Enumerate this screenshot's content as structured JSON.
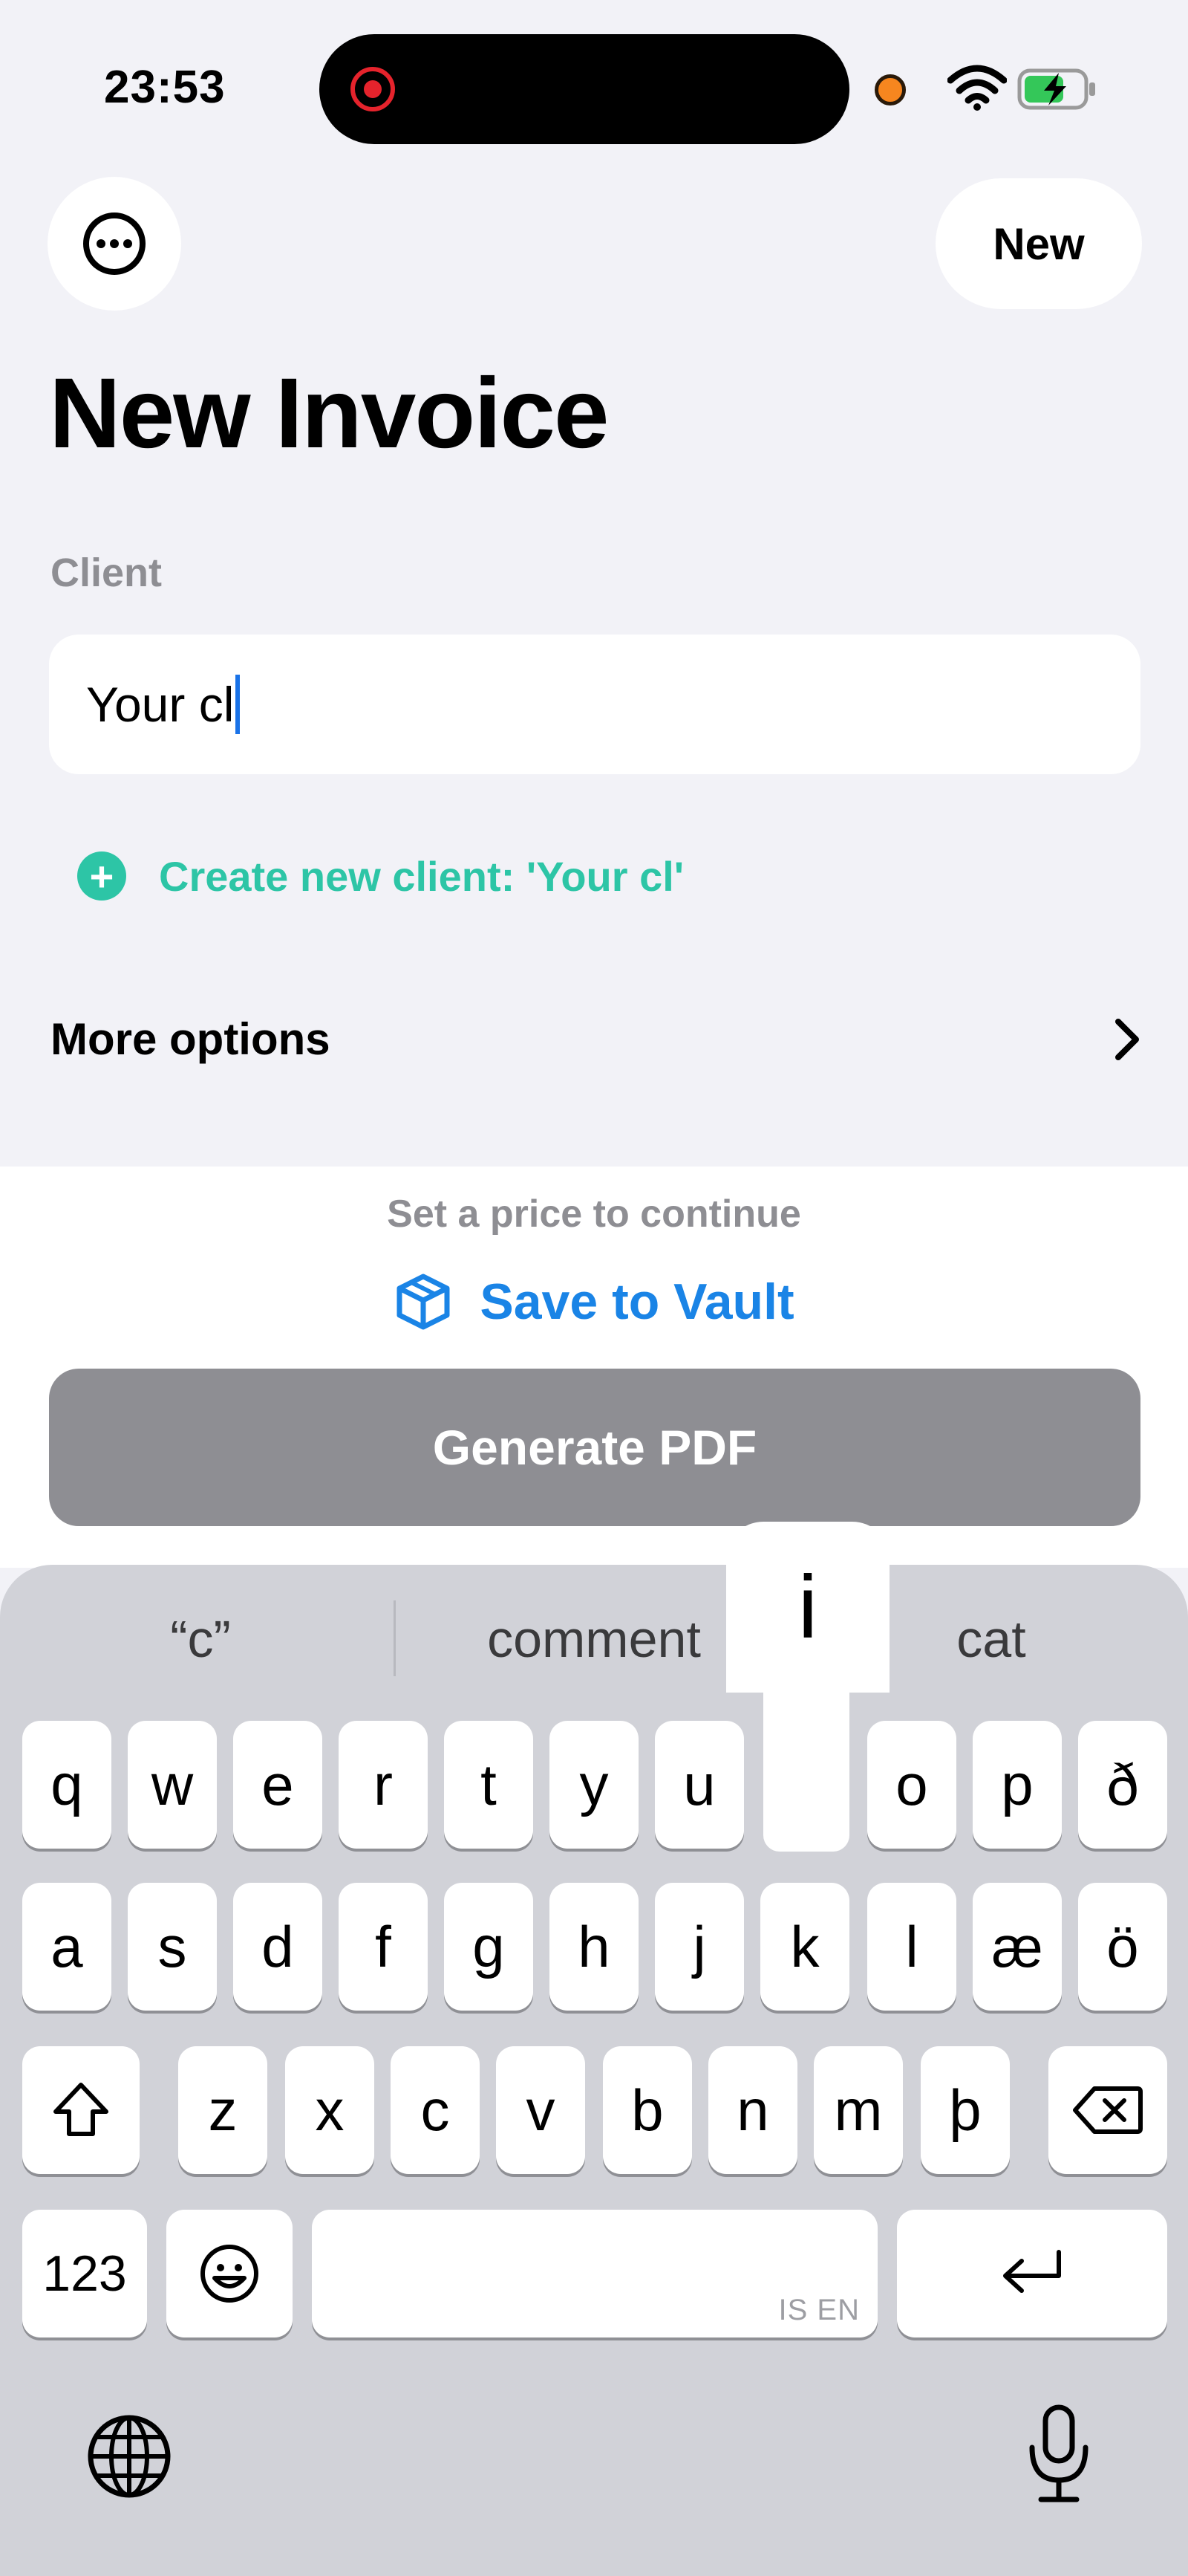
{
  "status_bar": {
    "time": "23:53"
  },
  "header": {
    "menu_icon": "ellipsis-circle-icon",
    "new_label": "New",
    "title": "New Invoice"
  },
  "form": {
    "client_label": "Client",
    "client_value": "Your cl",
    "create_client_text": "Create new client: 'Your cl'",
    "more_options_label": "More options"
  },
  "footer": {
    "hint": "Set a price to continue",
    "save_to_vault_label": "Save to Vault",
    "generate_pdf_label": "Generate PDF"
  },
  "keyboard": {
    "suggestions": [
      "“c”",
      "comment",
      "cat"
    ],
    "popup_key": "i",
    "row1": [
      "q",
      "w",
      "e",
      "r",
      "t",
      "y",
      "u",
      "i",
      "o",
      "p",
      "ð"
    ],
    "row2": [
      "a",
      "s",
      "d",
      "f",
      "g",
      "h",
      "j",
      "k",
      "l",
      "æ",
      "ö"
    ],
    "row3": [
      "z",
      "x",
      "c",
      "v",
      "b",
      "n",
      "m",
      "þ"
    ],
    "numbers_label": "123",
    "space_lang": "IS EN"
  },
  "colors": {
    "accent_green": "#2dc5a6",
    "accent_blue": "#1a84e6",
    "disabled_gray": "#8e8e93"
  }
}
